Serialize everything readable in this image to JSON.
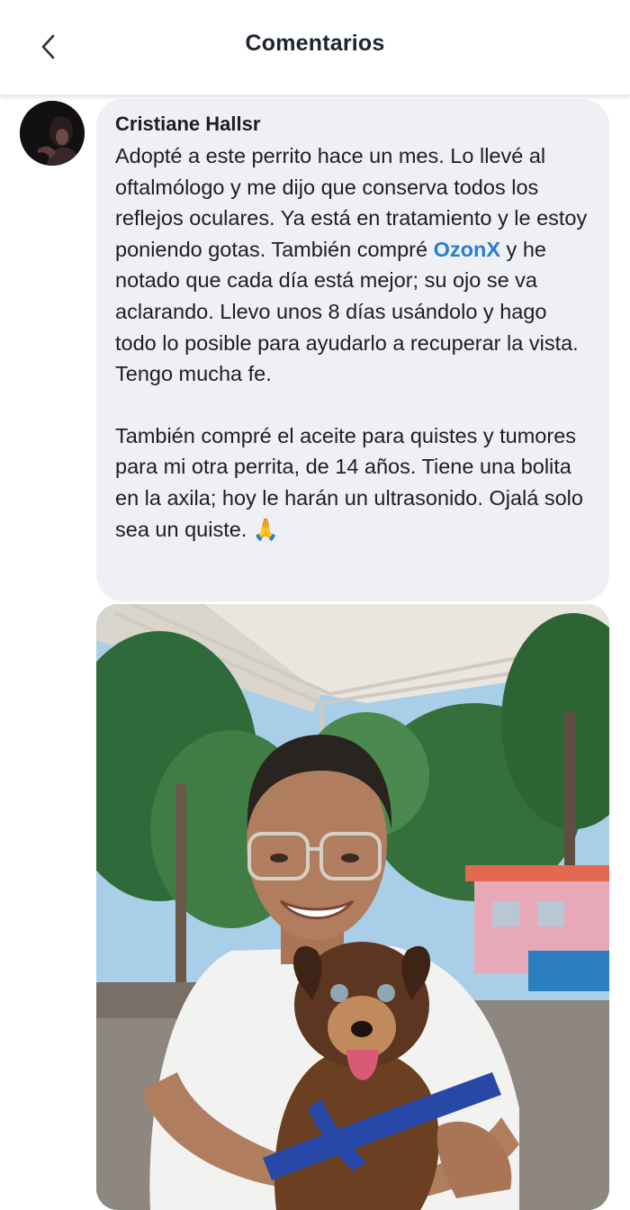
{
  "header": {
    "title": "Comentarios",
    "back_icon": "chevron-left-icon"
  },
  "comment": {
    "author": "Cristiane Hallsr",
    "paragraph1_before": "Adopté a este perrito hace un mes. Lo llevé al oftalmólogo y me dijo que conserva todos los reflejos oculares. Ya está en tratamiento y le estoy poniendo gotas. También compré ",
    "link_text": "OzonX",
    "paragraph1_after": " y he notado que cada día está mejor; su ojo se va aclarando. Llevo unos 8 días usándolo y hago todo lo posible para ayudarlo a recuperar la vista. Tengo mucha fe.",
    "paragraph2": "También compré el aceite para quistes y tumores para mi otra perrita, de 14 años. Tiene una bolita en la axila; hoy le harán un ultrasonido. Ojalá solo sea un quiste.",
    "emoji": "🙏"
  },
  "colors": {
    "link": "#2a7dd4",
    "bubble": "#eef0f3",
    "title": "#1c2430"
  }
}
